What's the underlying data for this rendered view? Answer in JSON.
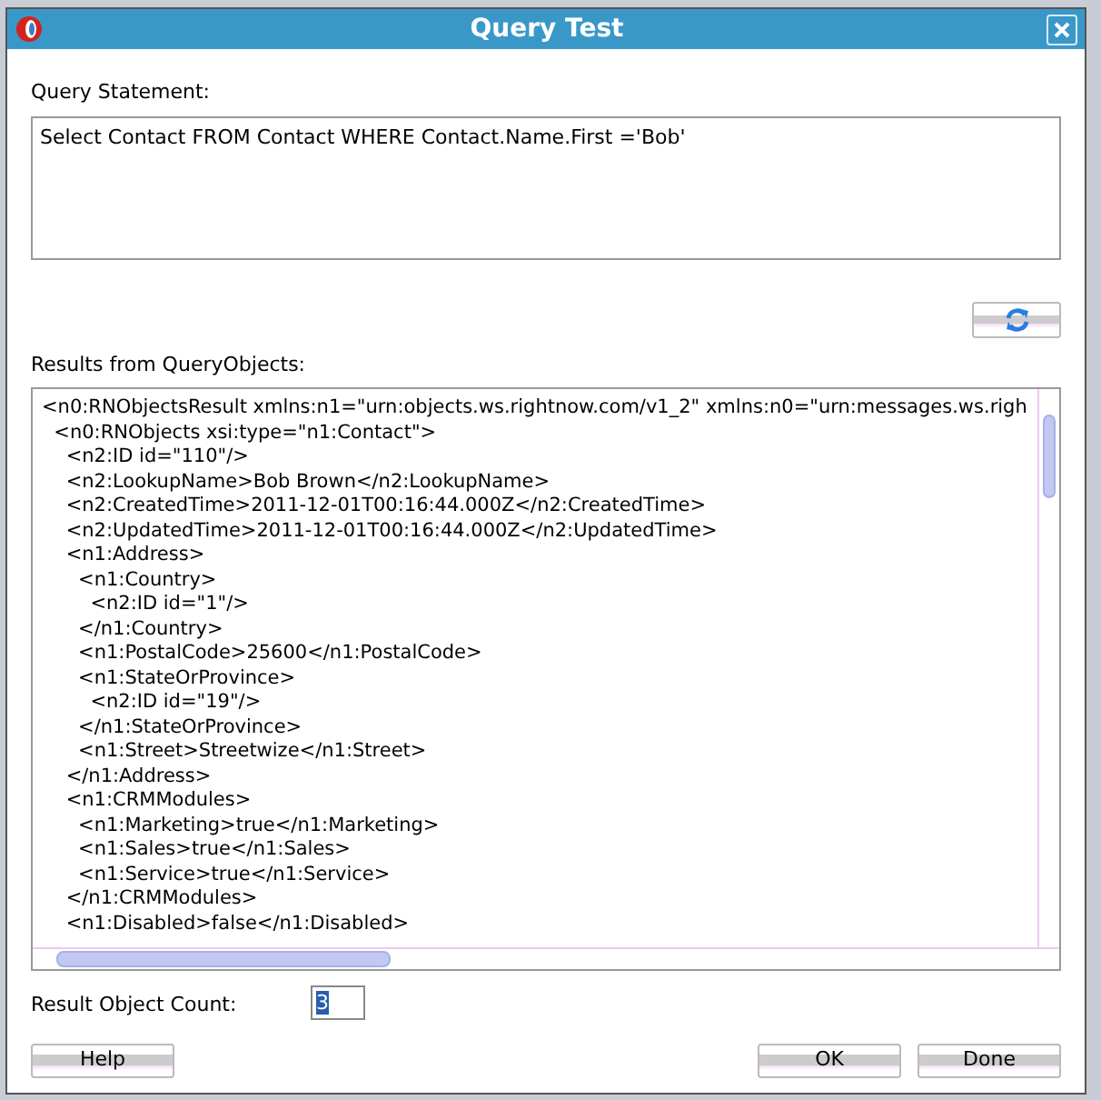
{
  "window": {
    "title": "Query Test"
  },
  "query": {
    "label": "Query Statement:",
    "value": "Select Contact FROM Contact WHERE Contact.Name.First ='Bob'"
  },
  "results": {
    "label": "Results from QueryObjects:",
    "lines": [
      "<n0:RNObjectsResult xmlns:n1=\"urn:objects.ws.rightnow.com/v1_2\" xmlns:n0=\"urn:messages.ws.righ",
      "  <n0:RNObjects xsi:type=\"n1:Contact\">",
      "    <n2:ID id=\"110\"/>",
      "    <n2:LookupName>Bob Brown</n2:LookupName>",
      "    <n2:CreatedTime>2011-12-01T00:16:44.000Z</n2:CreatedTime>",
      "    <n2:UpdatedTime>2011-12-01T00:16:44.000Z</n2:UpdatedTime>",
      "    <n1:Address>",
      "      <n1:Country>",
      "        <n2:ID id=\"1\"/>",
      "      </n1:Country>",
      "      <n1:PostalCode>25600</n1:PostalCode>",
      "      <n1:StateOrProvince>",
      "        <n2:ID id=\"19\"/>",
      "      </n1:StateOrProvince>",
      "      <n1:Street>Streetwize</n1:Street>",
      "    </n1:Address>",
      "    <n1:CRMModules>",
      "      <n1:Marketing>true</n1:Marketing>",
      "      <n1:Sales>true</n1:Sales>",
      "      <n1:Service>true</n1:Service>",
      "    </n1:CRMModules>",
      "    <n1:Disabled>false</n1:Disabled>"
    ]
  },
  "count": {
    "label": "Result Object Count:",
    "value": "3"
  },
  "buttons": [
    {
      "label": "Help",
      "kind": "left"
    },
    {
      "label": "OK",
      "kind": "right"
    },
    {
      "label": "Done",
      "kind": "right"
    }
  ]
}
